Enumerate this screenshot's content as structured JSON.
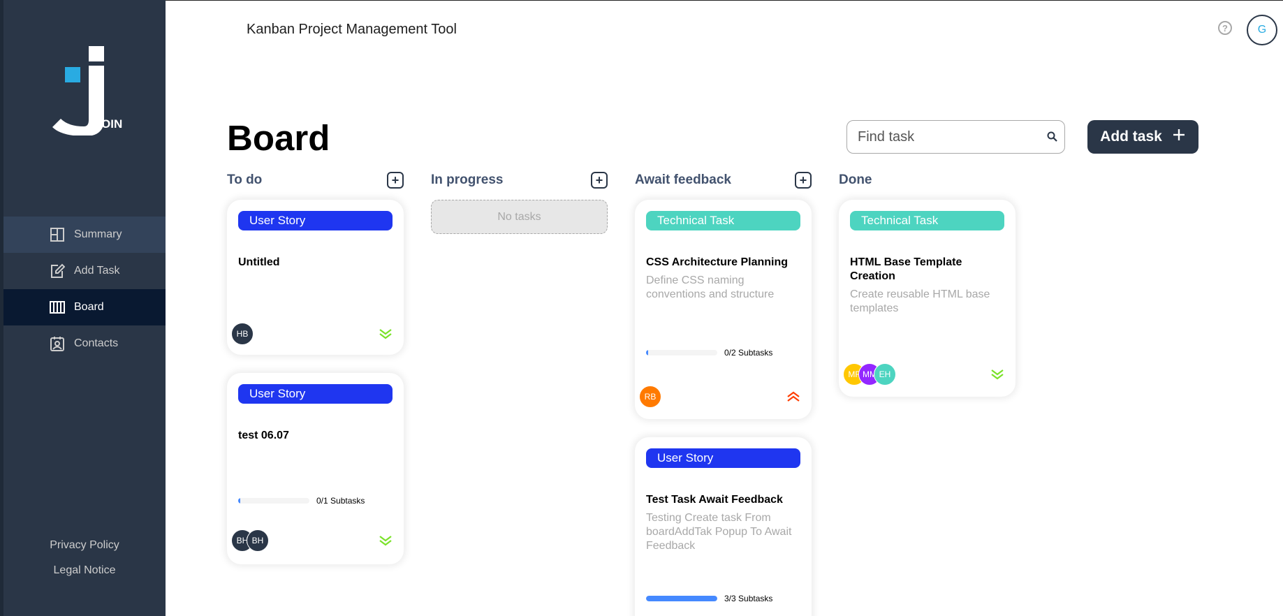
{
  "app": {
    "title": "Kanban Project Management Tool",
    "help_symbol": "?",
    "user_initial": "G"
  },
  "logo": {
    "text": "OIN"
  },
  "sidebar": {
    "items": [
      {
        "label": "Summary",
        "icon": "summary-icon",
        "state": "hover"
      },
      {
        "label": "Add Task",
        "icon": "add-task-icon",
        "state": "normal"
      },
      {
        "label": "Board",
        "icon": "board-icon",
        "state": "active"
      },
      {
        "label": "Contacts",
        "icon": "contacts-icon",
        "state": "normal"
      }
    ],
    "privacy_policy": "Privacy Policy",
    "legal_notice": "Legal Notice"
  },
  "board": {
    "title": "Board",
    "search_placeholder": "Find task",
    "add_task_label": "Add task",
    "add_symbol": "+"
  },
  "columns": [
    {
      "title": "To do",
      "plus": "+"
    },
    {
      "title": "In progress",
      "plus": "+",
      "empty_text": "No tasks"
    },
    {
      "title": "Await feedback",
      "plus": "+"
    },
    {
      "title": "Done"
    }
  ],
  "cards": {
    "todo_1": {
      "category": "User Story",
      "title": "Untitled",
      "assignees": [
        {
          "initials": "HB",
          "color": "#2a3647"
        }
      ],
      "priority": "low"
    },
    "todo_2": {
      "category": "User Story",
      "title": "test 06.07",
      "subtasks_label": "0/1 Subtasks",
      "progress": 0.03,
      "assignees": [
        {
          "initials": "BH",
          "color": "#2a3647"
        },
        {
          "initials": "BH",
          "color": "#2a3647"
        }
      ],
      "priority": "low"
    },
    "await_1": {
      "category": "Technical Task",
      "title": "CSS Architecture Planning",
      "description": "Define CSS naming conventions and structure",
      "subtasks_label": "0/2 Subtasks",
      "progress": 0.03,
      "assignees": [
        {
          "initials": "RB",
          "color": "#ff7a00"
        }
      ],
      "priority": "urgent"
    },
    "await_2": {
      "category": "User Story",
      "title": "Test Task Await Feedback",
      "description": "Testing Create task From boardAddTak Popup To Await Feedback",
      "subtasks_label": "3/3 Subtasks",
      "progress": 1.0
    },
    "done_1": {
      "category": "Technical Task",
      "title": "HTML Base Template Creation",
      "description": "Create reusable HTML base templates",
      "assignees": [
        {
          "initials": "MF",
          "color": "#ffc701"
        },
        {
          "initials": "MM",
          "color": "#9327ff"
        },
        {
          "initials": "EH",
          "color": "#4dd4c0"
        }
      ],
      "priority": "low"
    }
  },
  "colors": {
    "sidebar": "#2a3647",
    "nav_active": "#091931",
    "user_story": "#1f36f0",
    "technical_task": "#4dd4c0",
    "low_priority": "#7ae229",
    "urgent_priority": "#ff3d00",
    "accent": "#29abe2"
  }
}
